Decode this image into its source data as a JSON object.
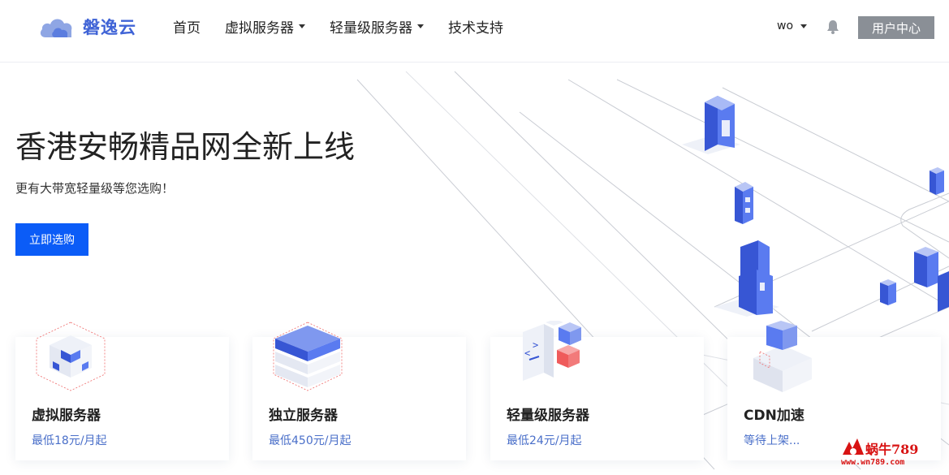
{
  "header": {
    "logo_text": "磐逸云",
    "nav": [
      {
        "label": "首页"
      },
      {
        "label": "虚拟服务器"
      },
      {
        "label": "轻量级服务器"
      },
      {
        "label": "技术支持"
      }
    ],
    "user_name": "wo",
    "user_center_label": "用户中心"
  },
  "hero": {
    "title": "香港安畅精品网全新上线",
    "subtitle": "更有大带宽轻量级等您选购！",
    "cta_label": "立即选购"
  },
  "cards": [
    {
      "title": "虚拟服务器",
      "price": "最低18元/月起",
      "icon": "cube-icon"
    },
    {
      "title": "独立服务器",
      "price": "最低450元/月起",
      "icon": "server-stack-icon"
    },
    {
      "title": "轻量级服务器",
      "price": "最低24元/月起",
      "icon": "code-blocks-icon"
    },
    {
      "title": "CDN加速",
      "price": "等待上架...",
      "icon": "cdn-box-icon"
    }
  ],
  "watermark": {
    "main": "蜗牛789",
    "url": "www.wn789.com"
  },
  "colors": {
    "brand_blue": "#3f63d6",
    "cta_blue": "#0b5cf7",
    "user_center_bg": "#8a8f96",
    "price_blue": "#4a6fc9",
    "watermark_red": "#d81313"
  }
}
